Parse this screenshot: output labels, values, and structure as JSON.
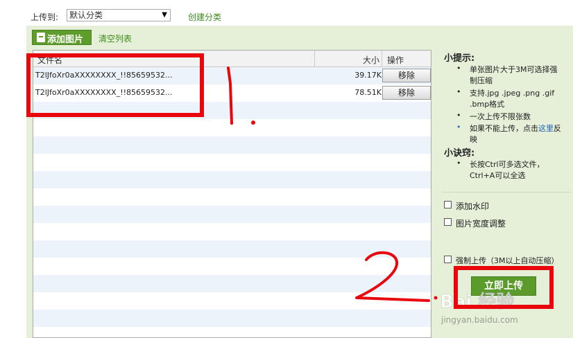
{
  "top_bar": {
    "upload_to_label": "上传到:",
    "category_selected": "默认分类",
    "create_category_link": "创建分类"
  },
  "toolbar": {
    "add_image_label": "添加图片",
    "clear_list_label": "清空列表"
  },
  "table": {
    "columns": [
      "文件名",
      "大小",
      "操作"
    ],
    "rows": [
      {
        "name": "T2lJfoXr0aXXXXXXXX_!!85659532...",
        "size": "39.17K",
        "action": "移除"
      },
      {
        "name": "T2lJfoXr0aXXXXXXXX_!!85659532...",
        "size": "78.51K",
        "action": "移除"
      }
    ]
  },
  "tips": {
    "title": "小提示:",
    "item1_line1": "单张图片大于3M可选择强",
    "item1_line2": "制压缩",
    "item2_line1": "支持.jpg .jpeg .png .gif",
    "item2_line2": ".bmp格式",
    "item3": "一次上传不限张数",
    "item4_before": "如果不能上传，点击",
    "item4_link": "这里",
    "item4_after": "反",
    "item4_line2": "映"
  },
  "tricks": {
    "title": "小诀窍:",
    "item1_line1": "长按Ctrl可多选文件，",
    "item1_line2": "Ctrl+A可以全选"
  },
  "options": {
    "watermark_label": "添加水印",
    "width_adjust_label": "图片宽度调整",
    "force_upload_label": "强制上传（3M以上自动压缩）"
  },
  "upload_now_label": "立即上传",
  "annotations": {
    "number_1": "1.",
    "number_2": "2"
  },
  "watermark": {
    "brand": "Bai 经验",
    "url": "jingyan.baidu.com"
  },
  "colors": {
    "green_panel": "#e6efd8",
    "button_green": "#5a9b2b",
    "link_green": "#3e8c1b",
    "annotation_red": "#e8070d",
    "row_stripe": "#edf3fb"
  }
}
